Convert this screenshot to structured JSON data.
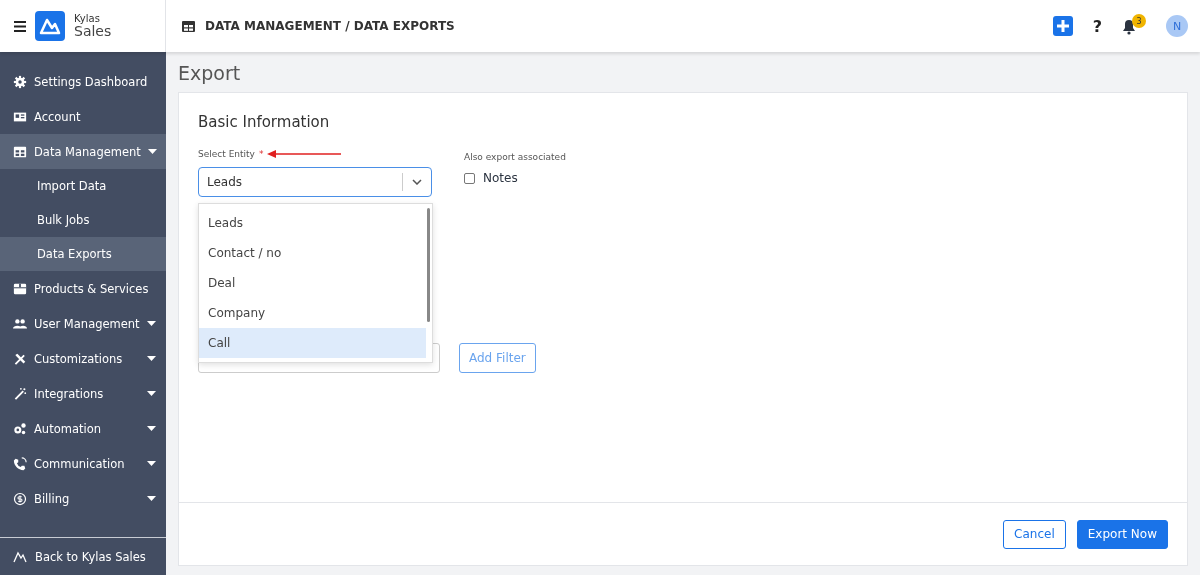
{
  "header": {
    "brand_top": "Kylas",
    "brand_bottom": "Sales",
    "breadcrumb": "DATA MANAGEMENT / DATA EXPORTS",
    "help": "?",
    "notification_count": "3",
    "avatar_initial": "N"
  },
  "sidebar": {
    "items": [
      {
        "label": "Settings Dashboard",
        "kind": "link",
        "selected": false
      },
      {
        "label": "Account",
        "kind": "link",
        "selected": false
      },
      {
        "label": "Data Management",
        "kind": "group",
        "selected": true,
        "children": [
          {
            "label": "Import Data",
            "selected": false
          },
          {
            "label": "Bulk Jobs",
            "selected": false
          },
          {
            "label": "Data Exports",
            "selected": true
          }
        ]
      },
      {
        "label": "Products & Services",
        "kind": "link",
        "selected": false
      },
      {
        "label": "User Management",
        "kind": "group",
        "selected": false
      },
      {
        "label": "Customizations",
        "kind": "group",
        "selected": false
      },
      {
        "label": "Integrations",
        "kind": "group",
        "selected": false
      },
      {
        "label": "Automation",
        "kind": "group",
        "selected": false
      },
      {
        "label": "Communication",
        "kind": "group",
        "selected": false
      },
      {
        "label": "Billing",
        "kind": "group",
        "selected": false
      }
    ],
    "footer_link": "Back to Kylas Sales"
  },
  "page": {
    "title": "Export",
    "section_title": "Basic Information",
    "entity_select": {
      "label": "Select Entity",
      "required_mark": "*",
      "value": "Leads",
      "options": [
        {
          "label": "Leads",
          "highlighted": false
        },
        {
          "label": "Contact / no",
          "highlighted": false
        },
        {
          "label": "Deal",
          "highlighted": false
        },
        {
          "label": "Company",
          "highlighted": false
        },
        {
          "label": "Call",
          "highlighted": true
        }
      ]
    },
    "associated": {
      "label": "Also export associated",
      "options": [
        {
          "label": "Notes",
          "checked": false
        }
      ]
    },
    "add_filter_button": "Add Filter",
    "buttons": [
      "Cancel",
      "Export Now"
    ]
  }
}
